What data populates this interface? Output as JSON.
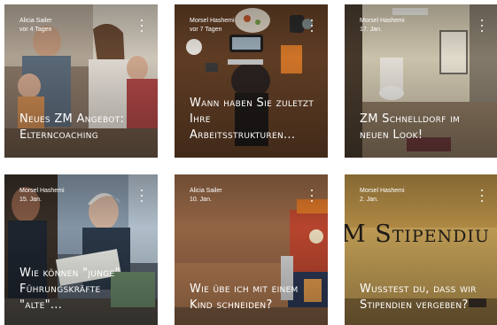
{
  "posts": [
    {
      "author": "Alicia Sailer",
      "date": "vor 4 Tagen",
      "title": "Neues ZM Angebot: Elterncoaching"
    },
    {
      "author": "Morsel Hashemi",
      "date": "vor 7 Tagen",
      "title": "Wann haben Sie zuletzt Ihre Arbeitsstrukturen..."
    },
    {
      "author": "Morsel Hashemi",
      "date": "17. Jan.",
      "title": "ZM Schnelldorf im neuen Look!"
    },
    {
      "author": "Morsel Hashemi",
      "date": "15. Jan.",
      "title": "Wie können \"junge\" Führungskräfte \"alte\"..."
    },
    {
      "author": "Alicia Sailer",
      "date": "10. Jan.",
      "title": "Wie übe ich mit einem Kind schneiden?"
    },
    {
      "author": "Morsel Hashemi",
      "date": "2. Jan.",
      "title": "Wusstest du, dass wir Stipendien vergeben?",
      "image_text": "M Stipendiu"
    }
  ],
  "more_options_icon": "vertical-dots-icon"
}
